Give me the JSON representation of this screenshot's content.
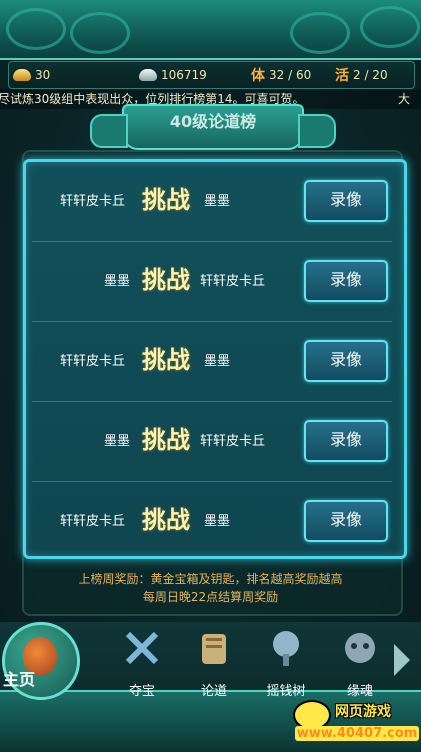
{
  "resources": {
    "gold": "30",
    "silver": "106719",
    "stamina_label": "体",
    "stamina": "32 / 60",
    "activity_label": "活",
    "activity": "2 / 20"
  },
  "marquee": {
    "text": "尽试炼30级组中表现出众，位列排行榜第14。可喜可贺。",
    "tail": "大"
  },
  "rank_title": "40级论道榜",
  "matches": [
    {
      "left": "轩轩皮卡丘",
      "vs": "挑战",
      "right": "墨墨",
      "button": "录像"
    },
    {
      "left": "墨墨",
      "vs": "挑战",
      "right": "轩轩皮卡丘",
      "button": "录像"
    },
    {
      "left": "轩轩皮卡丘",
      "vs": "挑战",
      "right": "墨墨",
      "button": "录像"
    },
    {
      "left": "墨墨",
      "vs": "挑战",
      "right": "轩轩皮卡丘",
      "button": "录像"
    },
    {
      "left": "轩轩皮卡丘",
      "vs": "挑战",
      "right": "墨墨",
      "button": "录像"
    }
  ],
  "reward": {
    "line1": "上榜周奖励：黄金宝箱及钥匙，排名越高奖励越高",
    "line2": "每周日晚22点结算周奖励"
  },
  "nav": {
    "home": "主页",
    "items": [
      "夺宝",
      "论道",
      "摇钱树",
      "缘魂"
    ]
  },
  "watermark": {
    "title": "网页游戏",
    "url": "www.40407.com"
  }
}
